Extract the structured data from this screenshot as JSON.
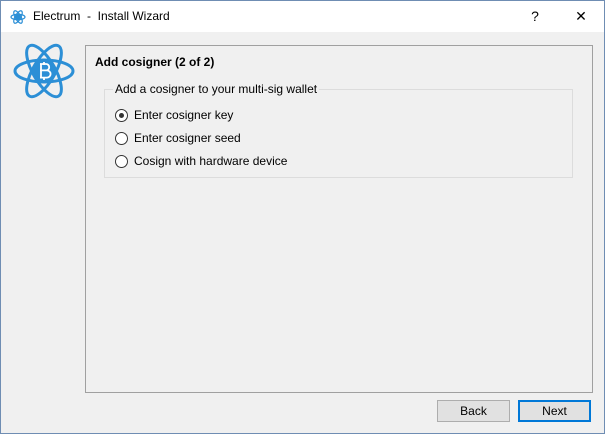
{
  "window": {
    "title": "Electrum  -  Install Wizard",
    "help_label": "?",
    "close_label": "✕"
  },
  "page": {
    "title": "Add cosigner (2 of 2)",
    "group_label": "Add a cosigner to your multi-sig wallet",
    "options": [
      {
        "label": "Enter cosigner key",
        "checked": true
      },
      {
        "label": "Enter cosigner seed",
        "checked": false
      },
      {
        "label": "Cosign with hardware device",
        "checked": false
      }
    ]
  },
  "buttons": {
    "back": "Back",
    "next": "Next"
  },
  "icons": {
    "app": "electrum-atom-icon",
    "logo": "electrum-logo-icon"
  },
  "colors": {
    "electrum_blue": "#2c8fd6",
    "accent_border": "#0078d7"
  }
}
